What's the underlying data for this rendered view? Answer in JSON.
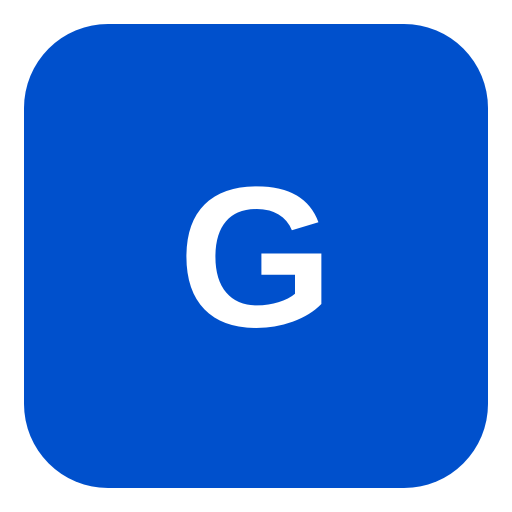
{
  "icon": {
    "letter": "G",
    "background_color": "#0050CC",
    "letter_color": "#FFFFFF"
  }
}
